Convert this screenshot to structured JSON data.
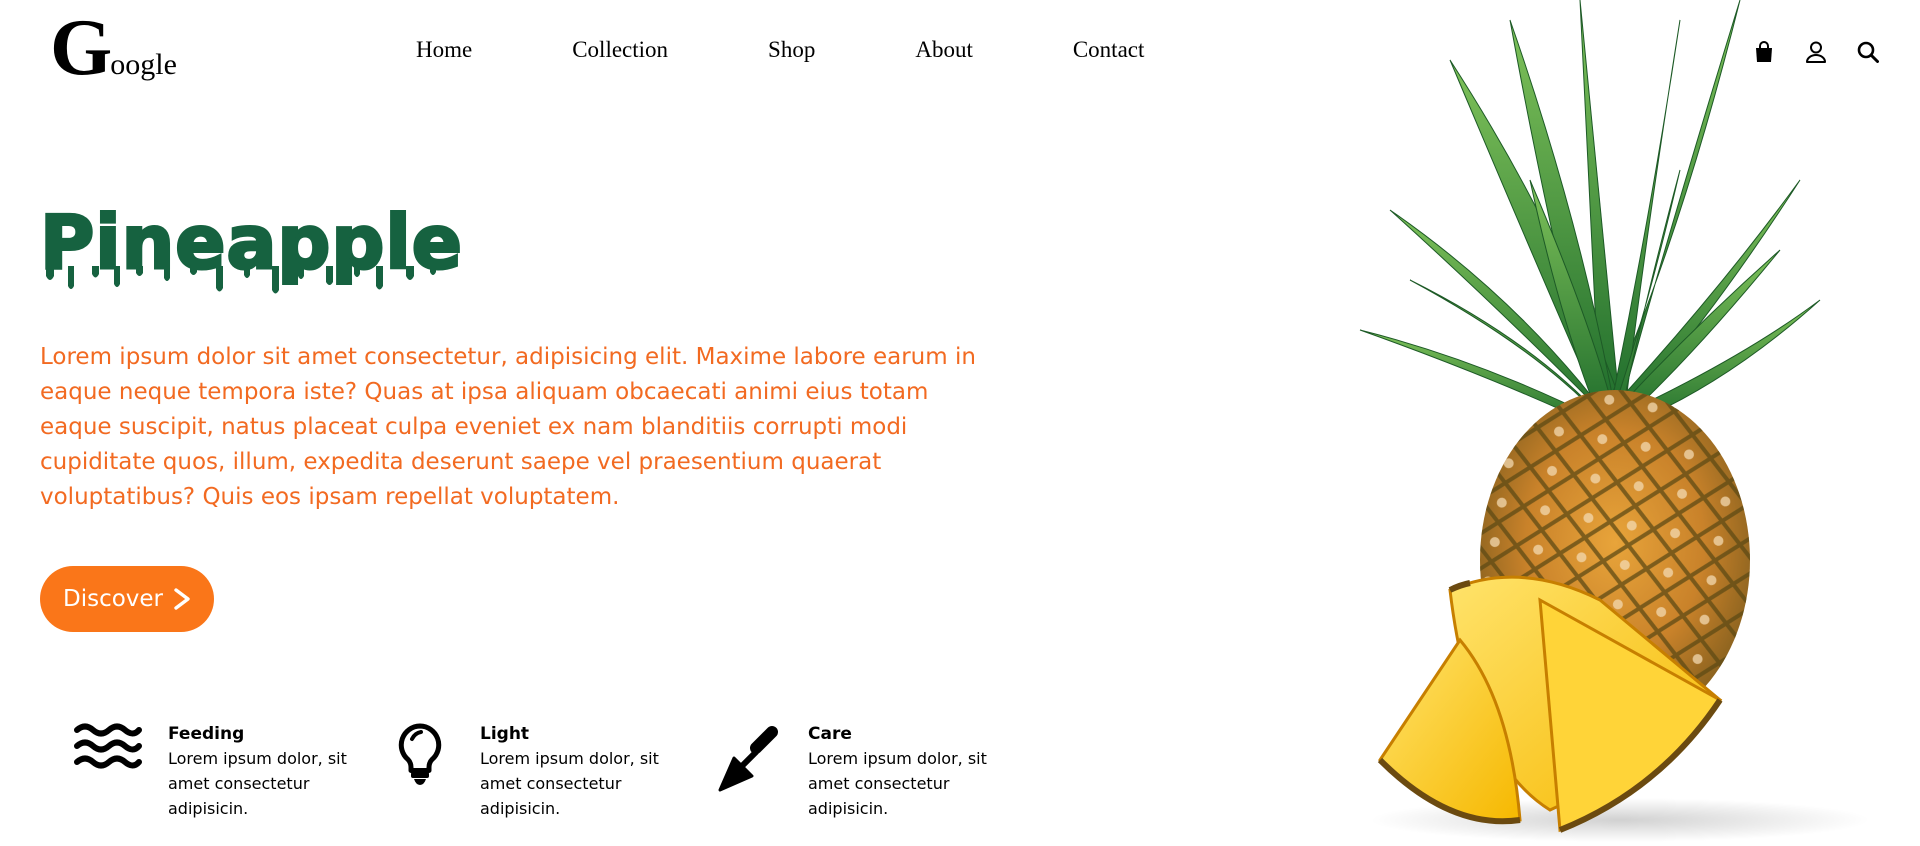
{
  "logo": {
    "first_letter": "G",
    "rest": "oogle"
  },
  "nav": {
    "items": [
      {
        "label": "Home"
      },
      {
        "label": "Collection"
      },
      {
        "label": "Shop"
      },
      {
        "label": "About"
      },
      {
        "label": "Contact"
      }
    ]
  },
  "header_icons": [
    "shopping-bag-icon",
    "user-icon",
    "search-icon"
  ],
  "hero": {
    "title": "Pineapple",
    "description": "Lorem ipsum dolor sit amet consectetur, adipisicing elit. Maxime labore earum in eaque neque tempora iste? Quas at ipsa aliquam obcaecati animi eius totam eaque suscipit, natus placeat culpa eveniet ex nam blanditiis corrupti modi cupiditate quos, illum, expedita deserunt saepe vel praesentium quaerat voluptatibus? Quis eos ipsam repellat voluptatem.",
    "button_label": "Discover"
  },
  "features": [
    {
      "icon": "waves-icon",
      "title": "Feeding",
      "description": "Lorem ipsum dolor, sit amet consectetur adipisicin."
    },
    {
      "icon": "lightbulb-icon",
      "title": "Light",
      "description": "Lorem ipsum dolor, sit amet consectetur adipisicin."
    },
    {
      "icon": "trowel-icon",
      "title": "Care",
      "description": "Lorem ipsum dolor, sit amet consectetur adipisicin."
    }
  ],
  "colors": {
    "title_green": "#166240",
    "text_orange": "#f26a21",
    "button_orange": "#fa7619"
  }
}
